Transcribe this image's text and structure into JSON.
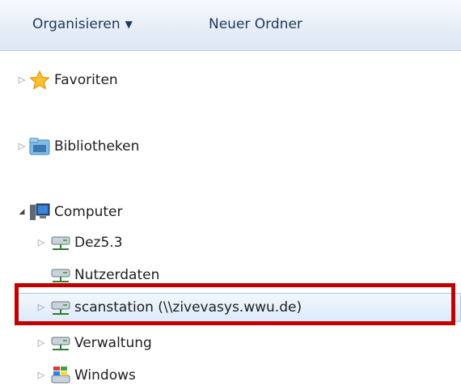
{
  "toolbar": {
    "organize_label": "Organisieren",
    "organize_caret": "▼",
    "new_folder_label": "Neuer Ordner"
  },
  "tree": {
    "favorites": {
      "label": "Favoriten",
      "expander": "▷",
      "icon": "star-icon"
    },
    "libraries": {
      "label": "Bibliotheken",
      "expander": "▷",
      "icon": "libraries-icon"
    },
    "computer": {
      "label": "Computer",
      "expander": "◢",
      "icon": "computer-icon"
    },
    "children": [
      {
        "label": "Dez5.3",
        "expander": "▷",
        "icon": "network-drive-icon"
      },
      {
        "label": "Nutzerdaten",
        "expander": "",
        "icon": "network-drive-icon"
      },
      {
        "label": "scanstation (\\\\zivevasys.wwu.de)",
        "expander": "▷",
        "icon": "network-drive-icon",
        "selected": true
      },
      {
        "label": "Verwaltung",
        "expander": "▷",
        "icon": "network-drive-icon"
      },
      {
        "label": "Windows",
        "expander": "▷",
        "icon": "windows-drive-icon"
      }
    ]
  },
  "colors": {
    "highlight_border": "#c00000",
    "selection": "#dceafb",
    "toolbar_text": "#1e395b"
  }
}
